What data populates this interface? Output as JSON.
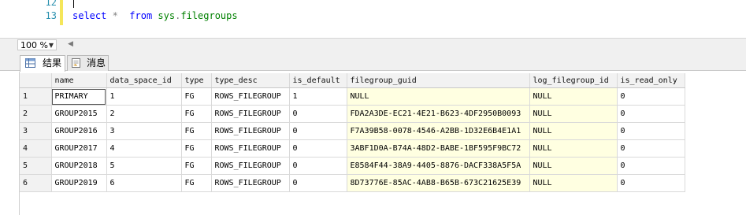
{
  "editor": {
    "lines": [
      {
        "number": "12",
        "code": ""
      },
      {
        "number": "13",
        "keyword_select": "select",
        "star": "*",
        "keyword_from": "from",
        "schema": "sys",
        "table": "filegroups"
      }
    ]
  },
  "zoom": {
    "value": "100 %"
  },
  "tabs": [
    {
      "label": "结果"
    },
    {
      "label": "消息"
    }
  ],
  "grid": {
    "columns": [
      "name",
      "data_space_id",
      "type",
      "type_desc",
      "is_default",
      "filegroup_guid",
      "log_filegroup_id",
      "is_read_only"
    ],
    "rows": [
      {
        "rn": "1",
        "cells": [
          "PRIMARY",
          "1",
          "FG",
          "ROWS_FILEGROUP",
          "1",
          "NULL",
          "NULL",
          "0"
        ]
      },
      {
        "rn": "2",
        "cells": [
          "GROUP2015",
          "2",
          "FG",
          "ROWS_FILEGROUP",
          "0",
          "FDA2A3DE-EC21-4E21-B623-4DF2950B0093",
          "NULL",
          "0"
        ]
      },
      {
        "rn": "3",
        "cells": [
          "GROUP2016",
          "3",
          "FG",
          "ROWS_FILEGROUP",
          "0",
          "F7A39B58-0078-4546-A2BB-1D32E6B4E1A1",
          "NULL",
          "0"
        ]
      },
      {
        "rn": "4",
        "cells": [
          "GROUP2017",
          "4",
          "FG",
          "ROWS_FILEGROUP",
          "0",
          "3ABF1D0A-B74A-48D2-BABE-1BF595F9BC72",
          "NULL",
          "0"
        ]
      },
      {
        "rn": "5",
        "cells": [
          "GROUP2018",
          "5",
          "FG",
          "ROWS_FILEGROUP",
          "0",
          "E8584F44-38A9-4405-8876-DACF338A5F5A",
          "NULL",
          "0"
        ]
      },
      {
        "rn": "6",
        "cells": [
          "GROUP2019",
          "6",
          "FG",
          "ROWS_FILEGROUP",
          "0",
          "8D73776E-85AC-4AB8-B65B-673C21625E39",
          "NULL",
          "0"
        ]
      }
    ]
  },
  "colors": {
    "highlight": "#ffffe1",
    "keyword": "#0000ff",
    "identifier": "#008000",
    "line_number": "#2b91af"
  }
}
